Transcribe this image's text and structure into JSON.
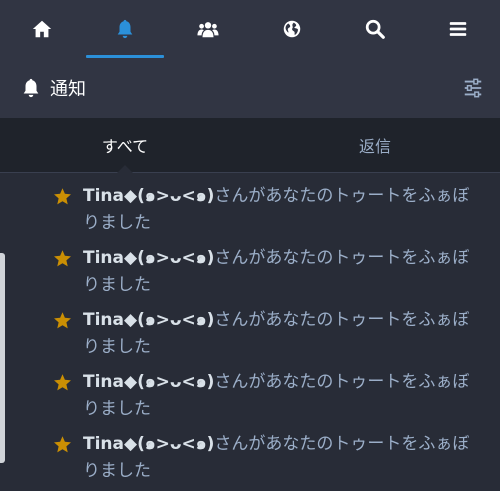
{
  "nav": {
    "tabs": [
      {
        "icon": "home-icon",
        "active": false
      },
      {
        "icon": "bell-icon",
        "active": true
      },
      {
        "icon": "users-icon",
        "active": false
      },
      {
        "icon": "globe-icon",
        "active": false
      },
      {
        "icon": "search-icon",
        "active": false
      },
      {
        "icon": "menu-icon",
        "active": false
      }
    ]
  },
  "column": {
    "title": "通知",
    "icon": "bell-icon",
    "settings_icon": "sliders-icon"
  },
  "filter": {
    "all_label": "すべて",
    "mentions_label": "返信"
  },
  "notifications": [
    {
      "name": "Tina◆(๑>ᴗ<๑)",
      "line1": "さんがあなたのトゥートをふぁぼ",
      "line2": "りました"
    },
    {
      "name": "Tina◆(๑>ᴗ<๑)",
      "line1": "さんがあなたのトゥートをふぁぼ",
      "line2": "りました"
    },
    {
      "name": "Tina◆(๑>ᴗ<๑)",
      "line1": "さんがあなたのトゥートをふぁぼ",
      "line2": "りました"
    },
    {
      "name": "Tina◆(๑>ᴗ<๑)",
      "line1": "さんがあなたのトゥートをふぁぼ",
      "line2": "りました"
    },
    {
      "name": "Tina◆(๑>ᴗ<๑)",
      "line1": "さんがあなたのトゥートをふぁぼ",
      "line2": "りました"
    }
  ],
  "colors": {
    "accent": "#2b90d9",
    "star": "#ca8f04",
    "background": "#282c37",
    "header": "#313543"
  }
}
